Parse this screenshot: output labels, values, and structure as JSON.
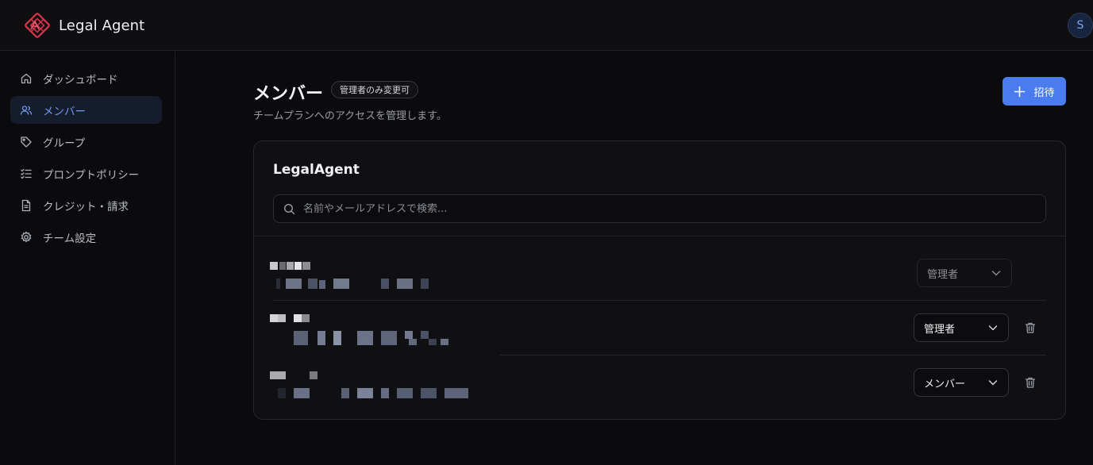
{
  "app": {
    "name": "Legal Agent"
  },
  "user": {
    "avatar_initial": "S"
  },
  "sidebar": {
    "items": [
      {
        "label": "ダッシュボード",
        "icon": "home-icon",
        "active": false
      },
      {
        "label": "メンバー",
        "icon": "users-icon",
        "active": true
      },
      {
        "label": "グループ",
        "icon": "tag-icon",
        "active": false
      },
      {
        "label": "プロンプトポリシー",
        "icon": "checklist-icon",
        "active": false
      },
      {
        "label": "クレジット・請求",
        "icon": "document-icon",
        "active": false
      },
      {
        "label": "チーム設定",
        "icon": "gear-icon",
        "active": false
      }
    ]
  },
  "page": {
    "title": "メンバー",
    "badge": "管理者のみ変更可",
    "subtitle": "チームプランへのアクセスを管理します。",
    "invite_label": "招待"
  },
  "team": {
    "name": "LegalAgent",
    "search_placeholder": "名前やメールアドレスで検索...",
    "members": [
      {
        "role": "管理者",
        "role_editable": false,
        "deletable": false
      },
      {
        "role": "管理者",
        "role_editable": true,
        "deletable": true
      },
      {
        "role": "メンバー",
        "role_editable": true,
        "deletable": true
      }
    ]
  },
  "colors": {
    "accent": "#4a7cf0",
    "active_nav_bg": "#151c2b",
    "active_nav_text": "#6f9af2",
    "brand_logo": "#d8344a"
  }
}
